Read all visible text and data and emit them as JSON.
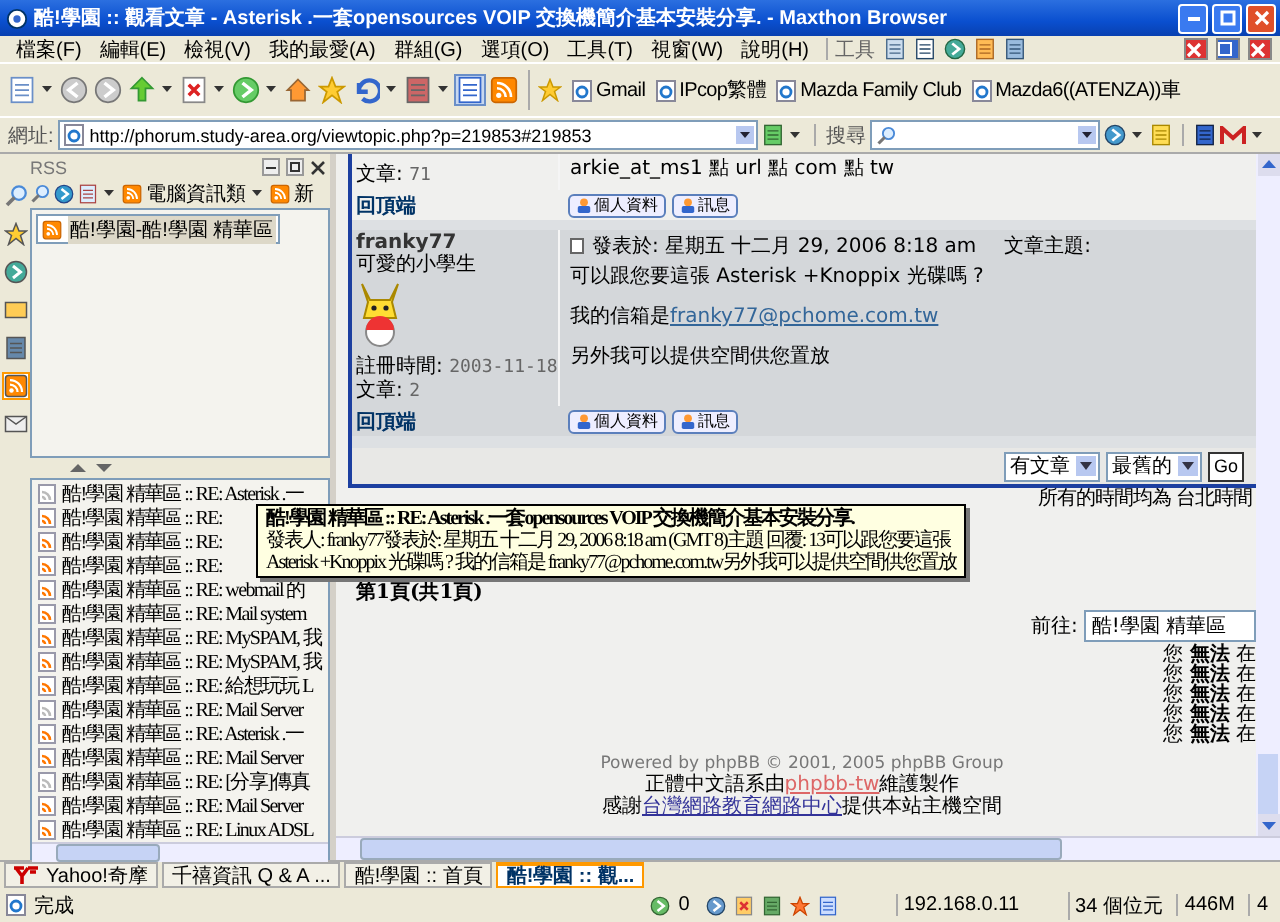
{
  "window": {
    "title": "酷!學園 :: 觀看文章 - Asterisk .一套opensources VOIP 交換機簡介基本安裝分享. - Maxthon Browser"
  },
  "menu_bar": {
    "items": [
      "檔案(F)",
      "編輯(E)",
      "檢視(V)",
      "我的最愛(A)",
      "群組(G)",
      "選項(O)",
      "工具(T)",
      "視窗(W)",
      "說明(H)"
    ],
    "tools_label": "工具"
  },
  "toolbar": {
    "bookmarks": [
      "Gmail",
      "IPcop繁體",
      "Mazda Family Club",
      "Mazda6((ATENZA))車"
    ]
  },
  "address_bar": {
    "label": "網址:",
    "url": "http://phorum.study-area.org/viewtopic.php?p=219853#219853",
    "search_label": "搜尋"
  },
  "sidebar": {
    "title": "RSS",
    "rail": [
      {
        "kind": "search",
        "selected": false
      },
      {
        "kind": "favorites",
        "selected": false
      },
      {
        "kind": "history",
        "selected": false
      },
      {
        "kind": "folder",
        "selected": false
      },
      {
        "kind": "notes",
        "selected": false
      },
      {
        "kind": "rss",
        "selected": true
      },
      {
        "kind": "mail",
        "selected": false
      }
    ],
    "feed_group": "電腦資訊類",
    "feed_next": "新",
    "feeds": [
      {
        "label": "酷!學園-酷!學園 精華區",
        "selected": true
      }
    ],
    "items": [
      {
        "label": "酷!學園 精華區 :: RE: Asterisk .一",
        "read": true
      },
      {
        "label": "酷!學園 精華區 :: RE:",
        "read": false
      },
      {
        "label": "酷!學園 精華區 :: RE:",
        "read": false
      },
      {
        "label": "酷!學園 精華區 :: RE:",
        "read": false
      },
      {
        "label": "酷!學園 精華區 :: RE: webmail 的",
        "read": false
      },
      {
        "label": "酷!學園 精華區 :: RE: Mail system",
        "read": false
      },
      {
        "label": "酷!學園 精華區 :: RE: MySPAM, 我",
        "read": false
      },
      {
        "label": "酷!學園 精華區 :: RE: MySPAM, 我",
        "read": false
      },
      {
        "label": "酷!學園 精華區 :: RE: 給想玩玩 L",
        "read": false
      },
      {
        "label": "酷!學園 精華區 :: RE: Mail Server",
        "read": true
      },
      {
        "label": "酷!學園 精華區 :: RE: Asterisk .一",
        "read": false
      },
      {
        "label": "酷!學園 精華區 :: RE: Mail Server",
        "read": false
      },
      {
        "label": "酷!學園 精華區 :: RE: [分享]傳真",
        "read": true
      },
      {
        "label": "酷!學園 精華區 :: RE: Mail Server",
        "read": false
      },
      {
        "label": "酷!學園 精華區 :: RE: Linux ADSL",
        "read": false
      }
    ]
  },
  "tooltip": {
    "title": "酷!學園 精華區 :: RE: Asterisk .一套opensources VOIP 交換機簡介基本安裝分享.",
    "lines": [
      "發表人: franky77發表於: 星期五 十二月 29, 2006 8:18 am (GMT 8)主題 回覆: 13可以跟您要這張",
      "Asterisk +Knoppix 光碟嗎 ? 我的信箱是 franky77@pchome.com.tw另外我可以提供空間供您置放"
    ]
  },
  "posts": [
    {
      "stats": [
        {
          "label": "文章:",
          "value": "71"
        }
      ],
      "paragraphs": [
        {
          "text": "arkie_at_ms1 點 url 點 com 點 tw"
        }
      ],
      "back_to_top": "回頂端",
      "buttons": [
        "個人資料",
        "訊息"
      ]
    },
    {
      "author": "franky77",
      "rank": "可愛的小學生",
      "avatar": true,
      "stats": [
        {
          "label": "註冊時間:",
          "value": "2003-11-18"
        },
        {
          "label": "文章:",
          "value": "2"
        }
      ],
      "posted": "發表於: 星期五 十二月 29, 2006 8:18 am",
      "subject_label": "文章主題:",
      "paragraphs": [
        {
          "text": "可以跟您要這張 Asterisk +Knoppix 光碟嗎 ?"
        },
        {
          "text": "我的信箱是",
          "link": "franky77@pchome.com.tw"
        },
        {
          "text": "另外我可以提供空間供您置放"
        }
      ],
      "back_to_top": "回頂端",
      "buttons": [
        "個人資料",
        "訊息"
      ]
    }
  ],
  "order_controls": {
    "selects": [
      "有文章",
      "最舊的"
    ],
    "go": "Go"
  },
  "timezone_note": "所有的時間均為 台北時間",
  "pagination": "第1頁(共1頁)",
  "jump": {
    "label": "前往:",
    "value": "酷!學園 精華區"
  },
  "permissions": [
    "您 **無法** 在",
    "您 **無法** 在",
    "您 **無法** 在",
    "您 **無法** 在",
    "您 **無法** 在"
  ],
  "footer": {
    "powered": "Powered by phpBB © 2001, 2005 phpBB Group",
    "translation": {
      "before": "正體中文語系由",
      "link": "phpbb-tw",
      "after": "維護製作"
    },
    "hosting": {
      "before": "感謝",
      "link": "台灣網路教育網路中心",
      "after": "提供本站主機空間"
    }
  },
  "tabs": [
    {
      "label": "Yahoo!奇摩",
      "kind": "yahoo",
      "selected": false
    },
    {
      "label": "千禧資訊 Q & A ...",
      "kind": "page",
      "selected": false
    },
    {
      "label": "酷!學園 :: 首頁",
      "kind": "page",
      "selected": false
    },
    {
      "label": "酷!學園 :: 觀...",
      "kind": "page",
      "selected": true
    }
  ],
  "status_bar": {
    "text": "完成",
    "count": "0",
    "ip": "192.168.0.11",
    "bytes": "34 個位元",
    "memory": "446M",
    "tabs": "4"
  }
}
